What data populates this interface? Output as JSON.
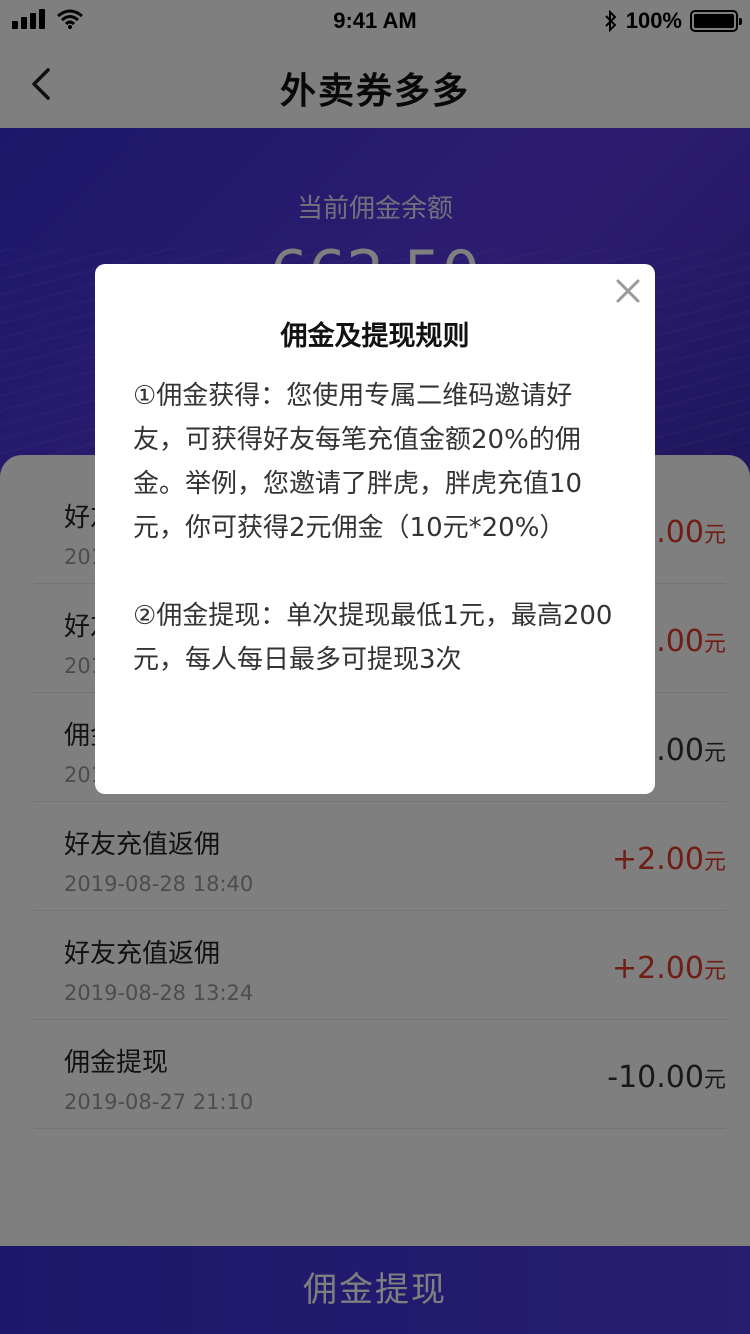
{
  "status_bar": {
    "time": "9:41 AM",
    "battery": "100%"
  },
  "nav": {
    "title": "外卖券多多"
  },
  "hero": {
    "label": "当前佣金余额",
    "amount": "662.50"
  },
  "records": [
    {
      "title": "好友充值返佣",
      "time": "2019-08-29 10:12",
      "amount": "+2.00",
      "unit": "元",
      "sign": "pos"
    },
    {
      "title": "好友充值返佣",
      "time": "2019-08-29 09:35",
      "amount": "+2.00",
      "unit": "元",
      "sign": "pos"
    },
    {
      "title": "佣金提现",
      "time": "2019-08-28 20:16",
      "amount": "-10.00",
      "unit": "元",
      "sign": "neg"
    },
    {
      "title": "好友充值返佣",
      "time": "2019-08-28 18:40",
      "amount": "+2.00",
      "unit": "元",
      "sign": "pos"
    },
    {
      "title": "好友充值返佣",
      "time": "2019-08-28 13:24",
      "amount": "+2.00",
      "unit": "元",
      "sign": "pos"
    },
    {
      "title": "佣金提现",
      "time": "2019-08-27 21:10",
      "amount": "-10.00",
      "unit": "元",
      "sign": "neg"
    }
  ],
  "withdraw_button": {
    "label": "佣金提现"
  },
  "modal": {
    "title": "佣金及提现规则",
    "rules": [
      "①佣金获得：您使用专属二维码邀请好友，可获得好友每笔充值金额20%的佣金。举例，您邀请了胖虎，胖虎充值10元，你可获得2元佣金（10元*20%）",
      "②佣金提现：单次提现最低1元，最高200元，每人每日最多可提现3次"
    ]
  },
  "colors": {
    "accent": "#3a2fd6",
    "positive": "#e03a2a",
    "mask": "rgba(0,0,0,0.5)"
  },
  "icons": {
    "back": "chevron-left-icon",
    "close": "close-icon",
    "signal": "signal-icon",
    "wifi": "wifi-icon",
    "bluetooth": "bluetooth-icon",
    "battery": "battery-icon"
  }
}
